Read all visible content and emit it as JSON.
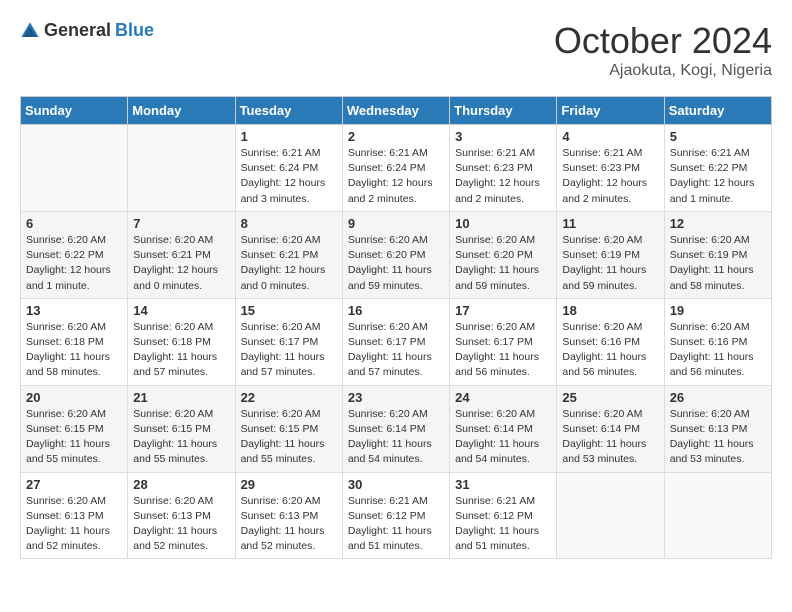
{
  "header": {
    "logo_general": "General",
    "logo_blue": "Blue",
    "month_year": "October 2024",
    "location": "Ajaokuta, Kogi, Nigeria"
  },
  "days_of_week": [
    "Sunday",
    "Monday",
    "Tuesday",
    "Wednesday",
    "Thursday",
    "Friday",
    "Saturday"
  ],
  "weeks": [
    [
      {
        "day": "",
        "sunrise": "",
        "sunset": "",
        "daylight": ""
      },
      {
        "day": "",
        "sunrise": "",
        "sunset": "",
        "daylight": ""
      },
      {
        "day": "1",
        "sunrise": "Sunrise: 6:21 AM",
        "sunset": "Sunset: 6:24 PM",
        "daylight": "Daylight: 12 hours and 3 minutes."
      },
      {
        "day": "2",
        "sunrise": "Sunrise: 6:21 AM",
        "sunset": "Sunset: 6:24 PM",
        "daylight": "Daylight: 12 hours and 2 minutes."
      },
      {
        "day": "3",
        "sunrise": "Sunrise: 6:21 AM",
        "sunset": "Sunset: 6:23 PM",
        "daylight": "Daylight: 12 hours and 2 minutes."
      },
      {
        "day": "4",
        "sunrise": "Sunrise: 6:21 AM",
        "sunset": "Sunset: 6:23 PM",
        "daylight": "Daylight: 12 hours and 2 minutes."
      },
      {
        "day": "5",
        "sunrise": "Sunrise: 6:21 AM",
        "sunset": "Sunset: 6:22 PM",
        "daylight": "Daylight: 12 hours and 1 minute."
      }
    ],
    [
      {
        "day": "6",
        "sunrise": "Sunrise: 6:20 AM",
        "sunset": "Sunset: 6:22 PM",
        "daylight": "Daylight: 12 hours and 1 minute."
      },
      {
        "day": "7",
        "sunrise": "Sunrise: 6:20 AM",
        "sunset": "Sunset: 6:21 PM",
        "daylight": "Daylight: 12 hours and 0 minutes."
      },
      {
        "day": "8",
        "sunrise": "Sunrise: 6:20 AM",
        "sunset": "Sunset: 6:21 PM",
        "daylight": "Daylight: 12 hours and 0 minutes."
      },
      {
        "day": "9",
        "sunrise": "Sunrise: 6:20 AM",
        "sunset": "Sunset: 6:20 PM",
        "daylight": "Daylight: 11 hours and 59 minutes."
      },
      {
        "day": "10",
        "sunrise": "Sunrise: 6:20 AM",
        "sunset": "Sunset: 6:20 PM",
        "daylight": "Daylight: 11 hours and 59 minutes."
      },
      {
        "day": "11",
        "sunrise": "Sunrise: 6:20 AM",
        "sunset": "Sunset: 6:19 PM",
        "daylight": "Daylight: 11 hours and 59 minutes."
      },
      {
        "day": "12",
        "sunrise": "Sunrise: 6:20 AM",
        "sunset": "Sunset: 6:19 PM",
        "daylight": "Daylight: 11 hours and 58 minutes."
      }
    ],
    [
      {
        "day": "13",
        "sunrise": "Sunrise: 6:20 AM",
        "sunset": "Sunset: 6:18 PM",
        "daylight": "Daylight: 11 hours and 58 minutes."
      },
      {
        "day": "14",
        "sunrise": "Sunrise: 6:20 AM",
        "sunset": "Sunset: 6:18 PM",
        "daylight": "Daylight: 11 hours and 57 minutes."
      },
      {
        "day": "15",
        "sunrise": "Sunrise: 6:20 AM",
        "sunset": "Sunset: 6:17 PM",
        "daylight": "Daylight: 11 hours and 57 minutes."
      },
      {
        "day": "16",
        "sunrise": "Sunrise: 6:20 AM",
        "sunset": "Sunset: 6:17 PM",
        "daylight": "Daylight: 11 hours and 57 minutes."
      },
      {
        "day": "17",
        "sunrise": "Sunrise: 6:20 AM",
        "sunset": "Sunset: 6:17 PM",
        "daylight": "Daylight: 11 hours and 56 minutes."
      },
      {
        "day": "18",
        "sunrise": "Sunrise: 6:20 AM",
        "sunset": "Sunset: 6:16 PM",
        "daylight": "Daylight: 11 hours and 56 minutes."
      },
      {
        "day": "19",
        "sunrise": "Sunrise: 6:20 AM",
        "sunset": "Sunset: 6:16 PM",
        "daylight": "Daylight: 11 hours and 56 minutes."
      }
    ],
    [
      {
        "day": "20",
        "sunrise": "Sunrise: 6:20 AM",
        "sunset": "Sunset: 6:15 PM",
        "daylight": "Daylight: 11 hours and 55 minutes."
      },
      {
        "day": "21",
        "sunrise": "Sunrise: 6:20 AM",
        "sunset": "Sunset: 6:15 PM",
        "daylight": "Daylight: 11 hours and 55 minutes."
      },
      {
        "day": "22",
        "sunrise": "Sunrise: 6:20 AM",
        "sunset": "Sunset: 6:15 PM",
        "daylight": "Daylight: 11 hours and 55 minutes."
      },
      {
        "day": "23",
        "sunrise": "Sunrise: 6:20 AM",
        "sunset": "Sunset: 6:14 PM",
        "daylight": "Daylight: 11 hours and 54 minutes."
      },
      {
        "day": "24",
        "sunrise": "Sunrise: 6:20 AM",
        "sunset": "Sunset: 6:14 PM",
        "daylight": "Daylight: 11 hours and 54 minutes."
      },
      {
        "day": "25",
        "sunrise": "Sunrise: 6:20 AM",
        "sunset": "Sunset: 6:14 PM",
        "daylight": "Daylight: 11 hours and 53 minutes."
      },
      {
        "day": "26",
        "sunrise": "Sunrise: 6:20 AM",
        "sunset": "Sunset: 6:13 PM",
        "daylight": "Daylight: 11 hours and 53 minutes."
      }
    ],
    [
      {
        "day": "27",
        "sunrise": "Sunrise: 6:20 AM",
        "sunset": "Sunset: 6:13 PM",
        "daylight": "Daylight: 11 hours and 52 minutes."
      },
      {
        "day": "28",
        "sunrise": "Sunrise: 6:20 AM",
        "sunset": "Sunset: 6:13 PM",
        "daylight": "Daylight: 11 hours and 52 minutes."
      },
      {
        "day": "29",
        "sunrise": "Sunrise: 6:20 AM",
        "sunset": "Sunset: 6:13 PM",
        "daylight": "Daylight: 11 hours and 52 minutes."
      },
      {
        "day": "30",
        "sunrise": "Sunrise: 6:21 AM",
        "sunset": "Sunset: 6:12 PM",
        "daylight": "Daylight: 11 hours and 51 minutes."
      },
      {
        "day": "31",
        "sunrise": "Sunrise: 6:21 AM",
        "sunset": "Sunset: 6:12 PM",
        "daylight": "Daylight: 11 hours and 51 minutes."
      },
      {
        "day": "",
        "sunrise": "",
        "sunset": "",
        "daylight": ""
      },
      {
        "day": "",
        "sunrise": "",
        "sunset": "",
        "daylight": ""
      }
    ]
  ]
}
